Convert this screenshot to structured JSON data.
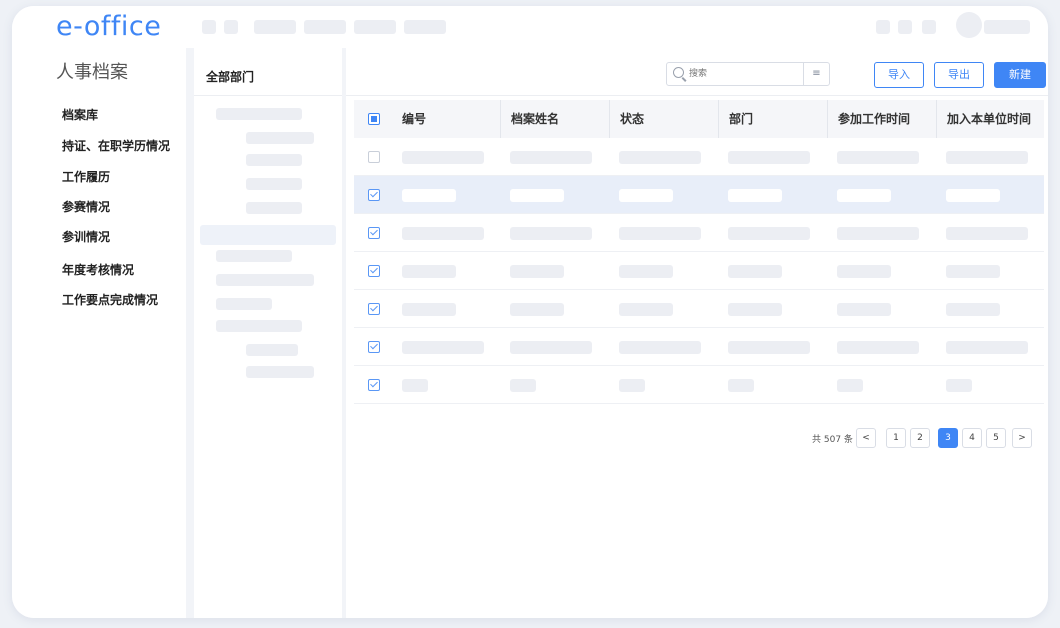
{
  "app": {
    "logo": "e-office"
  },
  "sidebar": {
    "title": "人事档案",
    "items": [
      {
        "label": "档案库"
      },
      {
        "label": "持证、在职学历情况"
      },
      {
        "label": "工作履历"
      },
      {
        "label": "参赛情况"
      },
      {
        "label": "参训情况"
      },
      {
        "label": "年度考核情况"
      },
      {
        "label": "工作要点完成情况"
      }
    ]
  },
  "tree": {
    "header": "全部部门"
  },
  "toolbar": {
    "search_placeholder": "搜索",
    "filter_icon": "≡",
    "import_label": "导入",
    "export_label": "导出",
    "new_label": "新建"
  },
  "table": {
    "columns": [
      "编号",
      "档案姓名",
      "状态",
      "部门",
      "参加工作时间",
      "加入本单位时间"
    ]
  },
  "pagination": {
    "total": "共 507 条",
    "prev": "<",
    "pages": [
      "1",
      "2",
      "3",
      "4",
      "5"
    ],
    "current": "3",
    "next": ">"
  },
  "colors": {
    "accent": "#3f86f5",
    "selected_row": "#e8eef9",
    "background": "#eef1f6"
  }
}
